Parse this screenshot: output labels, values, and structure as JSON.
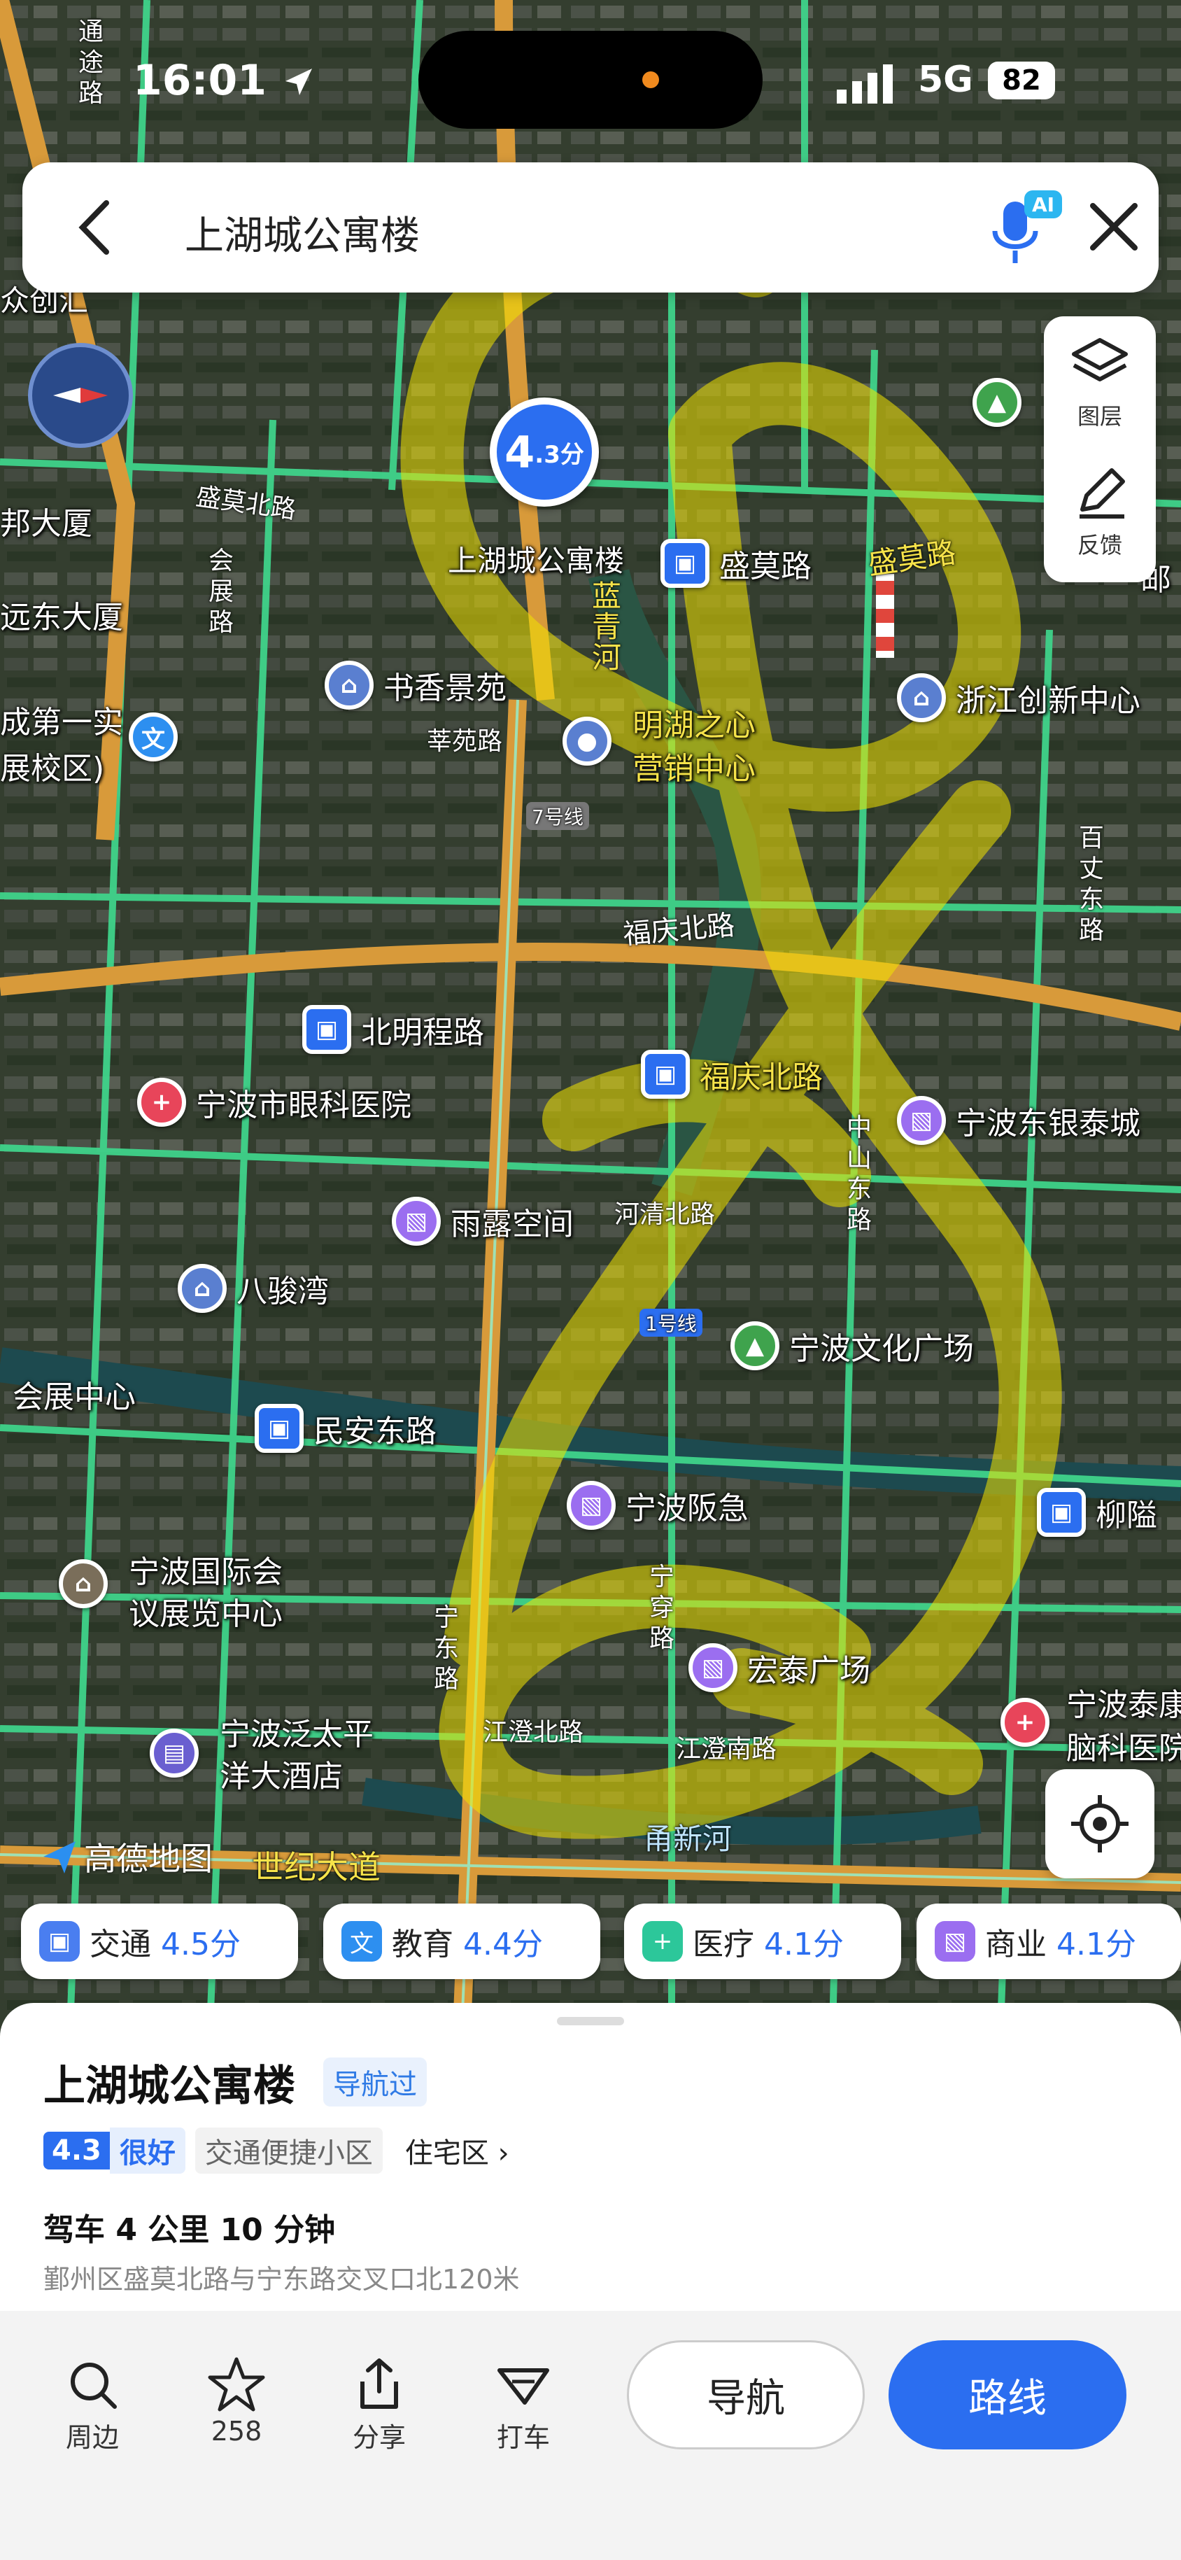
{
  "status_bar": {
    "time": "16:01",
    "network": "5G",
    "battery": "82"
  },
  "search": {
    "query": "上湖城公寓楼",
    "ai_badge": "AI"
  },
  "tools": {
    "layers": "图层",
    "feedback": "反馈"
  },
  "map": {
    "pin_score_big": "4",
    "pin_score_small": ".3分",
    "places": {
      "shanghucheng": "上湖城公寓楼",
      "shengmolu_station": "盛莫路",
      "shuxiang": "书香景苑",
      "minghu1": "明湖之心",
      "minghu2": "营销中心",
      "zhejiang": "浙江创新中心",
      "beimingcheng": "北明程路",
      "fuqing_station": "福庆北路",
      "yanke": "宁波市眼科医院",
      "yintai": "宁波东银泰城",
      "yulu": "雨露空间",
      "bajunwan": "八骏湾",
      "wenhua": "宁波文化广场",
      "huizhan": "会展中心",
      "minandong": "民安东路",
      "yuejie": "宁波阪急",
      "liuxiang": "柳隘",
      "guoji1": "宁波国际会",
      "guoji2": "议展览中心",
      "hongtai": "宏泰广场",
      "taiping1": "宁波泛太平",
      "taiping2": "洋大酒店",
      "naoke1": "宁波泰康",
      "naoke2": "脑科医院",
      "zhongchuang": "众创汇",
      "dasha": "邦大厦",
      "yuandong": "远东大厦",
      "shiyan1": "成第一实",
      "shiyan2": "展校区)",
      "lu_right": "邮"
    },
    "roads": {
      "shengmobei": "盛莫北路",
      "shengmo": "盛莫路",
      "lanqinghe": "蓝青河",
      "huayuan": "莘苑路",
      "line7": "7号线",
      "fuqingbei": "福庆北路",
      "heqingbei": "河清北路",
      "line1": "1号线",
      "jiangchengbei": "江澄北路",
      "jiangchengnan": "江澄南路",
      "yongxinhe": "甬新河",
      "shijidadao": "世纪大道",
      "ningdong": "宁东路",
      "ningchuan": "宁穿路",
      "zhongshandong": "中山东路",
      "baiwendong": "百丈东路",
      "huizhanlu": "会展路",
      "tongtulu": "通途路",
      "sheng": "盛"
    },
    "logo": "高德地图"
  },
  "chips": [
    {
      "label": "交通",
      "score": "4.5分",
      "color": "#4a7ef0"
    },
    {
      "label": "教育",
      "score": "4.4分",
      "color": "#2d8ff0"
    },
    {
      "label": "医疗",
      "score": "4.1分",
      "color": "#2cc79a"
    },
    {
      "label": "商业",
      "score": "4.1分",
      "color": "#9b6ef0"
    }
  ],
  "sheet": {
    "title": "上湖城公寓楼",
    "visited_tag": "导航过",
    "score": "4.3",
    "grade": "很好",
    "feature": "交通便捷小区",
    "type": "住宅区",
    "drive": "驾车 4 公里 10 分钟",
    "address": "鄞州区盛莫北路与宁东路交叉口北120米",
    "actions": {
      "nearby": "周边",
      "favorites": "258",
      "share": "分享",
      "taxi": "打车"
    },
    "navigate": "导航",
    "route": "路线"
  }
}
